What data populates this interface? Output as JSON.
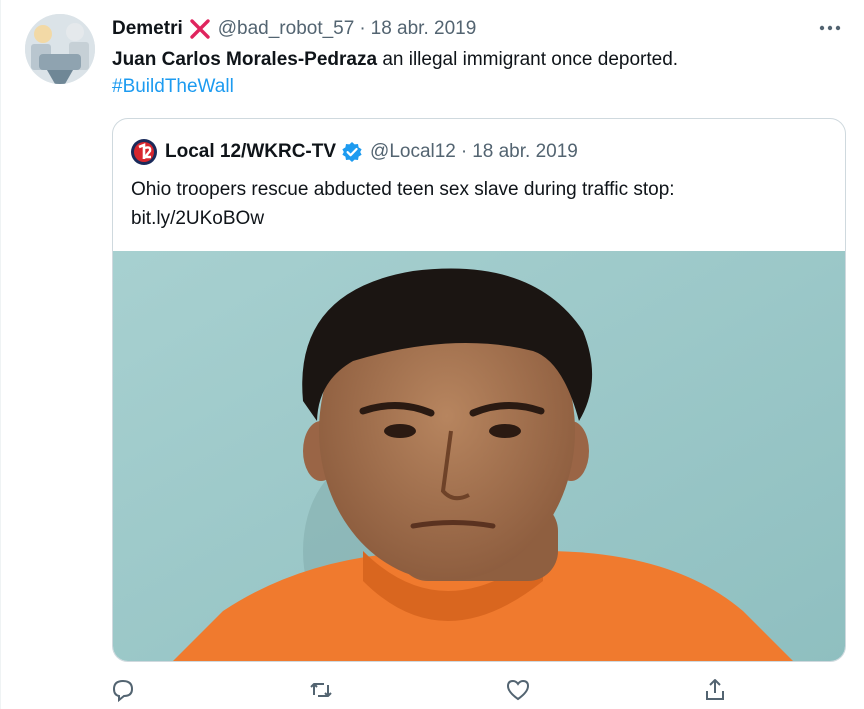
{
  "tweet": {
    "author": {
      "display_name": "Demetri",
      "badge_icon": "red-x-icon",
      "handle": "@bad_robot_57",
      "date": "18 abr. 2019"
    },
    "text_bold": "Juan Carlos Morales-Pedraza",
    "text_rest": " an illegal immigrant once deported.",
    "hashtag": "#BuildTheWall",
    "more_icon": "more-horizontal-icon"
  },
  "quoted": {
    "display_name": "Local 12/WKRC-TV",
    "verified_icon": "verified-badge-icon",
    "handle": "@Local12",
    "date": "18 abr. 2019",
    "text": "Ohio troopers rescue abducted teen sex slave during traffic stop:",
    "link": "bit.ly/2UKoBOw"
  },
  "actions": [
    "reply-icon",
    "retweet-icon",
    "like-icon",
    "share-icon"
  ],
  "colors": {
    "link": "#1d9bf0",
    "secondary_text": "#536471",
    "border": "#cfd9de",
    "badge_red": "#e0245e",
    "mug_background": "#9cc7c8",
    "shirt_orange": "#f07a2e"
  }
}
